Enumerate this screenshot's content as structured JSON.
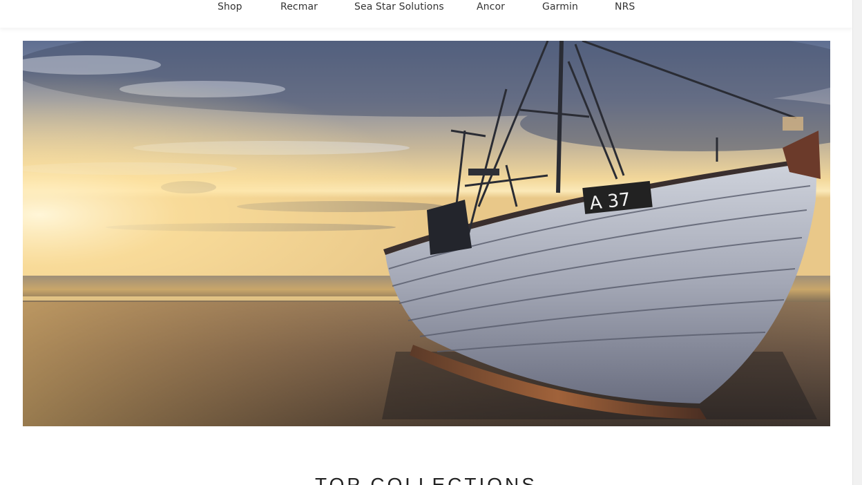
{
  "nav": {
    "items": [
      {
        "label": "Shop"
      },
      {
        "label": "Recmar"
      },
      {
        "label": "Sea Star Solutions"
      },
      {
        "label": "Ancor"
      },
      {
        "label": "Garmin"
      },
      {
        "label": "NRS"
      }
    ]
  },
  "hero": {
    "boat_number": "A 37"
  },
  "collections": {
    "title": "TOP COLLECTIONS"
  }
}
